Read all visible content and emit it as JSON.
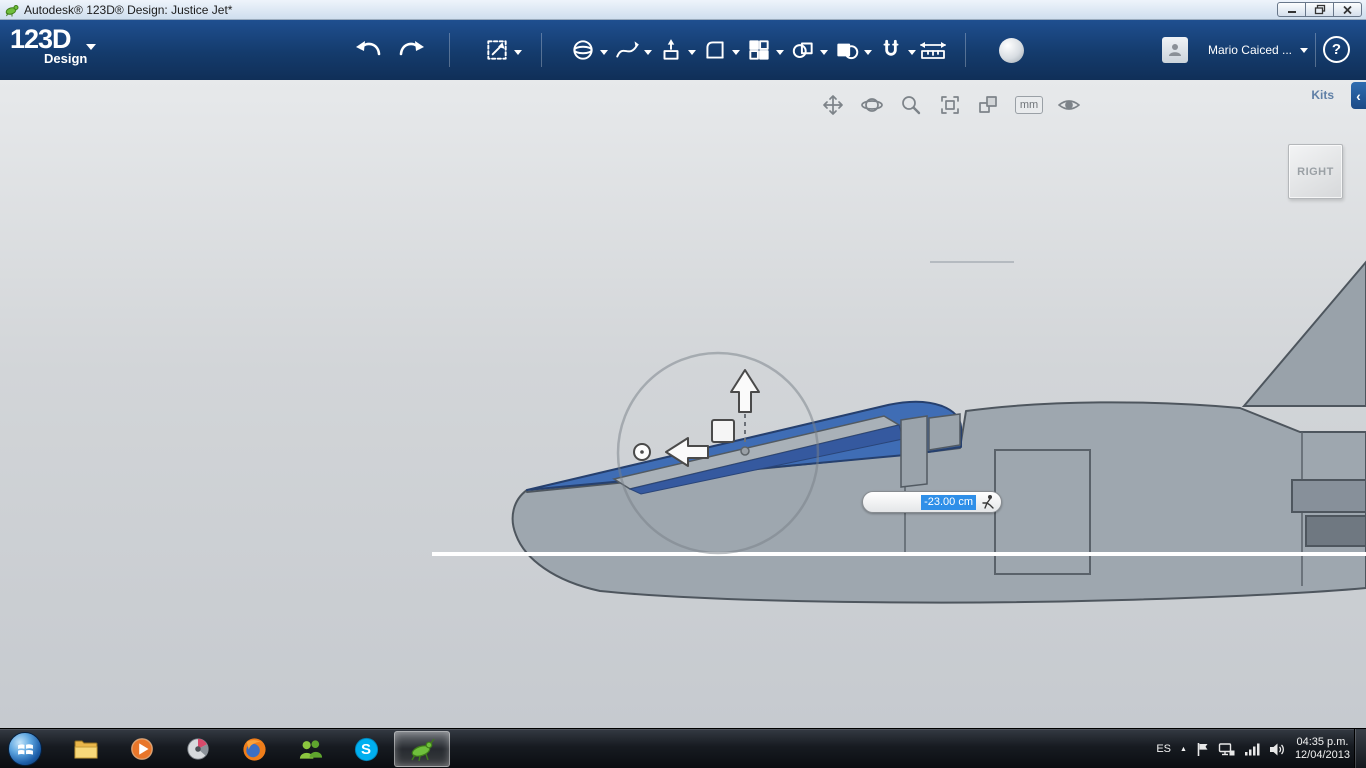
{
  "window": {
    "title": "Autodesk® 123D® Design: Justice Jet*"
  },
  "app_bar": {
    "logo_main": "123D",
    "logo_sub": "Design",
    "user_name": "Mario Caiced ...",
    "help_label": "?",
    "tools": [
      "undo",
      "redo",
      "transform",
      "primitives",
      "sketch",
      "construct",
      "modify",
      "pattern",
      "grouping",
      "combine",
      "snap",
      "measure",
      "render-material"
    ]
  },
  "nav_bar": {
    "unit_label": "mm",
    "kits_label": "Kits",
    "collapse_glyph": "‹",
    "tools": [
      "pan",
      "orbit",
      "zoom",
      "fit",
      "view-settings",
      "units",
      "visibility"
    ]
  },
  "viewcube": {
    "face_label": "RIGHT"
  },
  "canvas": {
    "dimension_value": "-23.00 cm"
  },
  "icons": {
    "skype_letter": "S",
    "hidden_icons_glyph": "▲"
  },
  "taskbar": {
    "language": "ES",
    "clock_time": "04:35 p.m.",
    "clock_date": "12/04/2013",
    "apps": [
      "start",
      "explorer",
      "media-player",
      "gauge-app",
      "firefox",
      "messenger",
      "skype",
      "123d-design-active"
    ]
  },
  "colors": {
    "appbar_navy": "#16406f",
    "selection_canopy_blue": "#3f6db5",
    "text_highlight_blue": "#2f8fe8",
    "canvas_gray": "#d2d5d8",
    "taskbar_black": "#14181d"
  }
}
